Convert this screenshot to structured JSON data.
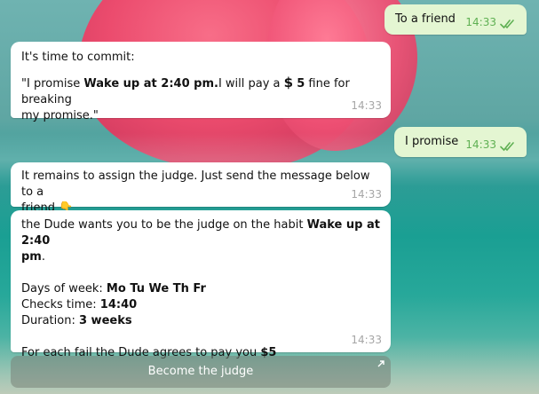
{
  "messages": {
    "to_friend": {
      "text": "To a friend",
      "time": "14:33"
    },
    "commit": {
      "intro": "It's time to commit:",
      "quote_open": "\"I promise ",
      "habit": "Wake up at 2:40 pm.",
      "mid": "I will pay a ",
      "dollar_sign": "$",
      "amount": "5",
      "tail_1": " fine for breaking",
      "tail_2": "my promise.\"",
      "time": "14:33"
    },
    "promise": {
      "text": "I promise",
      "time": "14:33"
    },
    "assign": {
      "line1": "It remains to assign the judge. Just send the message below to a",
      "line2": "friend",
      "emoji": "👇",
      "time": "14:33"
    },
    "invite": {
      "line1_prefix": "the Dude wants you to be the judge on the habit ",
      "line1_bold": "Wake up at 2:40",
      "line2_bold": "pm",
      "line2_suffix": ".",
      "days_label": "Days of week: ",
      "days_value": "Mo Tu We Th Fr",
      "checks_label": "Checks time: ",
      "checks_value": "14:40",
      "duration_label": "Duration: ",
      "duration_value": "3 weeks",
      "fail_label": "For each fail the Dude agrees to pay you ",
      "fail_value": "$5",
      "time": "14:33"
    }
  },
  "button": {
    "become_judge": "Become the judge"
  },
  "colors": {
    "outgoing_bg": "#e4f6d2",
    "incoming_bg": "#ffffff",
    "outgoing_time": "#5fb053",
    "incoming_time": "#a6a6a6"
  },
  "icons": {
    "read_receipt": "double-check-icon",
    "button_corner": "arrow-up-right-icon"
  }
}
